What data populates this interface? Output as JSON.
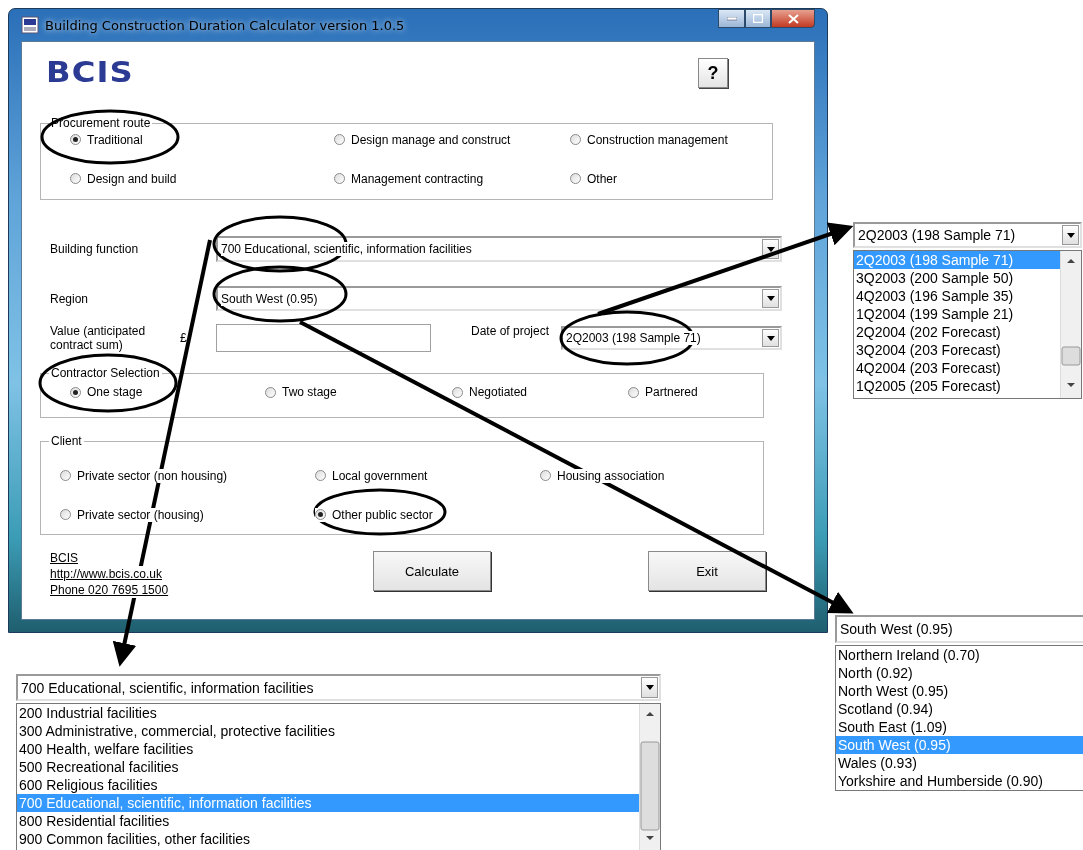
{
  "window": {
    "title": "Building Construction Duration Calculator version 1.0.5"
  },
  "logo": "BCIS",
  "help_button": "?",
  "procurement_route": {
    "label": "Procurement route",
    "options": [
      {
        "label": "Traditional",
        "selected": true
      },
      {
        "label": "Design manage and construct",
        "selected": false
      },
      {
        "label": "Construction management",
        "selected": false
      },
      {
        "label": "Design and build",
        "selected": false
      },
      {
        "label": "Management contracting",
        "selected": false
      },
      {
        "label": "Other",
        "selected": false
      }
    ]
  },
  "building_function": {
    "label": "Building function",
    "value": "700 Educational, scientific, information facilities"
  },
  "region": {
    "label": "Region",
    "value": "South West (0.95)"
  },
  "value_field": {
    "label": "Value (anticipated contract sum)",
    "currency": "£"
  },
  "date_of_project": {
    "label": "Date of project",
    "value": "2Q2003 (198 Sample 71)"
  },
  "contractor_selection": {
    "label": "Contractor Selection",
    "options": [
      {
        "label": "One stage",
        "selected": true
      },
      {
        "label": "Two stage",
        "selected": false
      },
      {
        "label": "Negotiated",
        "selected": false
      },
      {
        "label": "Partnered",
        "selected": false
      }
    ]
  },
  "client": {
    "label": "Client",
    "options": [
      {
        "label": "Private sector (non housing)",
        "selected": false
      },
      {
        "label": "Local government",
        "selected": false
      },
      {
        "label": "Housing association",
        "selected": false
      },
      {
        "label": "Private sector (housing)",
        "selected": false
      },
      {
        "label": "Other public sector",
        "selected": true
      }
    ]
  },
  "contact_links": [
    "BCIS",
    "http://www.bcis.co.uk",
    "Phone 020 7695 1500"
  ],
  "buttons": [
    "Calculate",
    "Exit"
  ],
  "date_dropdown": {
    "value": "2Q2003 (198 Sample 71)",
    "options": [
      {
        "label": "2Q2003 (198 Sample 71)",
        "selected": true
      },
      {
        "label": "3Q2003 (200 Sample 50)",
        "selected": false
      },
      {
        "label": "4Q2003 (196 Sample 35)",
        "selected": false
      },
      {
        "label": "1Q2004 (199 Sample 21)",
        "selected": false
      },
      {
        "label": "2Q2004 (202 Forecast)",
        "selected": false
      },
      {
        "label": "3Q2004 (203 Forecast)",
        "selected": false
      },
      {
        "label": "4Q2004 (203 Forecast)",
        "selected": false
      },
      {
        "label": "1Q2005 (205 Forecast)",
        "selected": false
      }
    ]
  },
  "region_dropdown": {
    "value": "South West (0.95)",
    "options": [
      {
        "label": "Northern Ireland (0.70)",
        "selected": false
      },
      {
        "label": "North (0.92)",
        "selected": false
      },
      {
        "label": "North West (0.95)",
        "selected": false
      },
      {
        "label": "Scotland (0.94)",
        "selected": false
      },
      {
        "label": "South East (1.09)",
        "selected": false
      },
      {
        "label": "South West (0.95)",
        "selected": true
      },
      {
        "label": "Wales (0.93)",
        "selected": false
      },
      {
        "label": "Yorkshire and Humberside (0.90)",
        "selected": false
      }
    ]
  },
  "building_function_dropdown": {
    "value": "700 Educational, scientific, information facilities",
    "options": [
      {
        "label": "200 Industrial facilities",
        "selected": false
      },
      {
        "label": "300 Administrative, commercial, protective facilities",
        "selected": false
      },
      {
        "label": "400 Health, welfare facilities",
        "selected": false
      },
      {
        "label": "500 Recreational facilities",
        "selected": false
      },
      {
        "label": "600 Religious facilities",
        "selected": false
      },
      {
        "label": "700 Educational, scientific, information facilities",
        "selected": true
      },
      {
        "label": "800 Residential facilities",
        "selected": false
      },
      {
        "label": "900 Common facilities, other facilities",
        "selected": false
      }
    ]
  }
}
